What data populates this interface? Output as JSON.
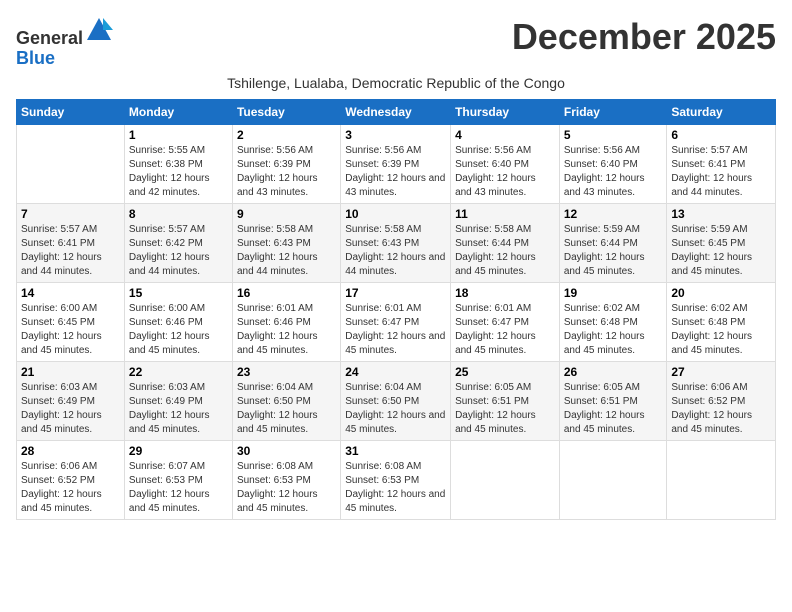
{
  "header": {
    "logo_general": "General",
    "logo_blue": "Blue",
    "month_title": "December 2025",
    "subtitle": "Tshilenge, Lualaba, Democratic Republic of the Congo"
  },
  "calendar": {
    "days_of_week": [
      "Sunday",
      "Monday",
      "Tuesday",
      "Wednesday",
      "Thursday",
      "Friday",
      "Saturday"
    ],
    "weeks": [
      [
        {
          "day": "",
          "info": ""
        },
        {
          "day": "1",
          "info": "Sunrise: 5:55 AM\nSunset: 6:38 PM\nDaylight: 12 hours and 42 minutes."
        },
        {
          "day": "2",
          "info": "Sunrise: 5:56 AM\nSunset: 6:39 PM\nDaylight: 12 hours and 43 minutes."
        },
        {
          "day": "3",
          "info": "Sunrise: 5:56 AM\nSunset: 6:39 PM\nDaylight: 12 hours and 43 minutes."
        },
        {
          "day": "4",
          "info": "Sunrise: 5:56 AM\nSunset: 6:40 PM\nDaylight: 12 hours and 43 minutes."
        },
        {
          "day": "5",
          "info": "Sunrise: 5:56 AM\nSunset: 6:40 PM\nDaylight: 12 hours and 43 minutes."
        },
        {
          "day": "6",
          "info": "Sunrise: 5:57 AM\nSunset: 6:41 PM\nDaylight: 12 hours and 44 minutes."
        }
      ],
      [
        {
          "day": "7",
          "info": "Sunrise: 5:57 AM\nSunset: 6:41 PM\nDaylight: 12 hours and 44 minutes."
        },
        {
          "day": "8",
          "info": "Sunrise: 5:57 AM\nSunset: 6:42 PM\nDaylight: 12 hours and 44 minutes."
        },
        {
          "day": "9",
          "info": "Sunrise: 5:58 AM\nSunset: 6:43 PM\nDaylight: 12 hours and 44 minutes."
        },
        {
          "day": "10",
          "info": "Sunrise: 5:58 AM\nSunset: 6:43 PM\nDaylight: 12 hours and 44 minutes."
        },
        {
          "day": "11",
          "info": "Sunrise: 5:58 AM\nSunset: 6:44 PM\nDaylight: 12 hours and 45 minutes."
        },
        {
          "day": "12",
          "info": "Sunrise: 5:59 AM\nSunset: 6:44 PM\nDaylight: 12 hours and 45 minutes."
        },
        {
          "day": "13",
          "info": "Sunrise: 5:59 AM\nSunset: 6:45 PM\nDaylight: 12 hours and 45 minutes."
        }
      ],
      [
        {
          "day": "14",
          "info": "Sunrise: 6:00 AM\nSunset: 6:45 PM\nDaylight: 12 hours and 45 minutes."
        },
        {
          "day": "15",
          "info": "Sunrise: 6:00 AM\nSunset: 6:46 PM\nDaylight: 12 hours and 45 minutes."
        },
        {
          "day": "16",
          "info": "Sunrise: 6:01 AM\nSunset: 6:46 PM\nDaylight: 12 hours and 45 minutes."
        },
        {
          "day": "17",
          "info": "Sunrise: 6:01 AM\nSunset: 6:47 PM\nDaylight: 12 hours and 45 minutes."
        },
        {
          "day": "18",
          "info": "Sunrise: 6:01 AM\nSunset: 6:47 PM\nDaylight: 12 hours and 45 minutes."
        },
        {
          "day": "19",
          "info": "Sunrise: 6:02 AM\nSunset: 6:48 PM\nDaylight: 12 hours and 45 minutes."
        },
        {
          "day": "20",
          "info": "Sunrise: 6:02 AM\nSunset: 6:48 PM\nDaylight: 12 hours and 45 minutes."
        }
      ],
      [
        {
          "day": "21",
          "info": "Sunrise: 6:03 AM\nSunset: 6:49 PM\nDaylight: 12 hours and 45 minutes."
        },
        {
          "day": "22",
          "info": "Sunrise: 6:03 AM\nSunset: 6:49 PM\nDaylight: 12 hours and 45 minutes."
        },
        {
          "day": "23",
          "info": "Sunrise: 6:04 AM\nSunset: 6:50 PM\nDaylight: 12 hours and 45 minutes."
        },
        {
          "day": "24",
          "info": "Sunrise: 6:04 AM\nSunset: 6:50 PM\nDaylight: 12 hours and 45 minutes."
        },
        {
          "day": "25",
          "info": "Sunrise: 6:05 AM\nSunset: 6:51 PM\nDaylight: 12 hours and 45 minutes."
        },
        {
          "day": "26",
          "info": "Sunrise: 6:05 AM\nSunset: 6:51 PM\nDaylight: 12 hours and 45 minutes."
        },
        {
          "day": "27",
          "info": "Sunrise: 6:06 AM\nSunset: 6:52 PM\nDaylight: 12 hours and 45 minutes."
        }
      ],
      [
        {
          "day": "28",
          "info": "Sunrise: 6:06 AM\nSunset: 6:52 PM\nDaylight: 12 hours and 45 minutes."
        },
        {
          "day": "29",
          "info": "Sunrise: 6:07 AM\nSunset: 6:53 PM\nDaylight: 12 hours and 45 minutes."
        },
        {
          "day": "30",
          "info": "Sunrise: 6:08 AM\nSunset: 6:53 PM\nDaylight: 12 hours and 45 minutes."
        },
        {
          "day": "31",
          "info": "Sunrise: 6:08 AM\nSunset: 6:53 PM\nDaylight: 12 hours and 45 minutes."
        },
        {
          "day": "",
          "info": ""
        },
        {
          "day": "",
          "info": ""
        },
        {
          "day": "",
          "info": ""
        }
      ]
    ]
  }
}
